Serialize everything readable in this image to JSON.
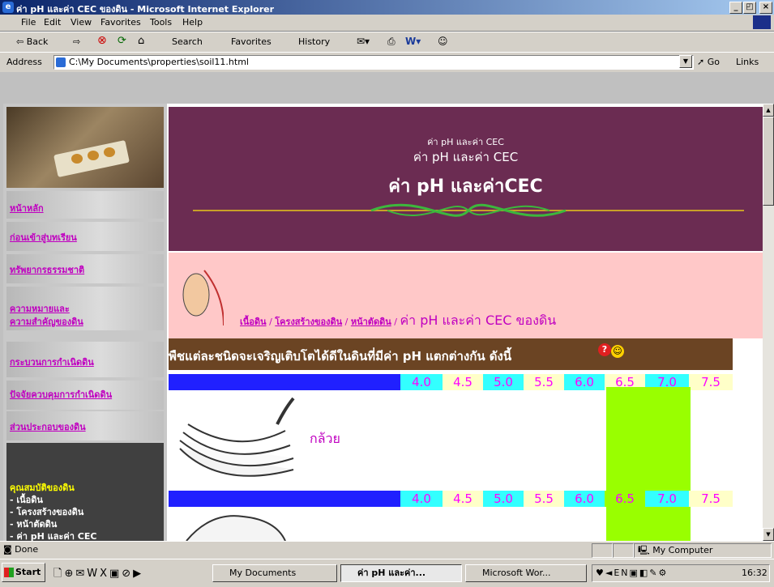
{
  "window": {
    "title": "ค่า pH และค่า CEC ของดิน - Microsoft Internet Explorer",
    "controls": [
      "_",
      "◰",
      "×"
    ]
  },
  "menu": [
    "File",
    "Edit",
    "View",
    "Favorites",
    "Tools",
    "Help"
  ],
  "toolbar": {
    "back": "⇦ Back",
    "forward": "⇨",
    "stop": "⊗",
    "refresh": "⟳",
    "home": "⌂",
    "search": "Search",
    "favorites": "Favorites",
    "history": "History"
  },
  "address": {
    "label": "Address",
    "value": "C:\\My Documents\\properties\\soil11.html",
    "go": "Go",
    "links": "Links"
  },
  "sidebar": {
    "nav": [
      "หน้าหลัก",
      "ก่อนเข้าสู่บทเรียน",
      "ทรัพยากรธรรมชาติ",
      "ความหมายและ",
      "ความสำคัญของดิน",
      "กระบวนการกำเนิดดิน",
      "ปัจจัยควบคุมการกำเนิดดิน",
      "ส่วนประกอบของดิน"
    ],
    "properties": [
      "คุณสมบัติของดิน",
      "- เนื้อดิน",
      "- โครงสร้างของดิน",
      "- หน้าตัดดิน"
    ]
  },
  "banner": {
    "small": "ค่า pH และค่า CEC",
    "mid": "ค่า pH และค่า CEC",
    "large": "ค่า pH และค่าCEC"
  },
  "breadcrumb": {
    "items": [
      "เนื้อดิน",
      "โครงสร้างของดิน",
      "หน้าตัดดิน"
    ],
    "current": "ค่า pH และค่า CEC ของดิน"
  },
  "intro": "พืชแต่ละชนิดจะเจริญเติบโตได้ดีในดินที่มีค่า pH แตกต่างกัน ดังนี้",
  "ph_scale": [
    "4.0",
    "4.5",
    "5.0",
    "5.5",
    "6.0",
    "6.5",
    "7.0",
    "7.5"
  ],
  "plants": [
    {
      "name": "กล้วย",
      "range_from": "6.5",
      "range_to": "7.0"
    }
  ],
  "colors": {
    "banner": "#6b2c52",
    "pink": "#ffc8c8",
    "brown": "#6b4423",
    "blue": "#2020ff",
    "cyan": "#33ffff",
    "yellow": "#ffffc8",
    "green": "#99ff00"
  },
  "status": {
    "left": "Done",
    "right": "My Computer"
  },
  "taskbar": {
    "start": "Start",
    "tasks": [
      "My Documents",
      "ค่า pH และค่า...",
      "Microsoft Wor..."
    ],
    "clock": "16:32"
  }
}
